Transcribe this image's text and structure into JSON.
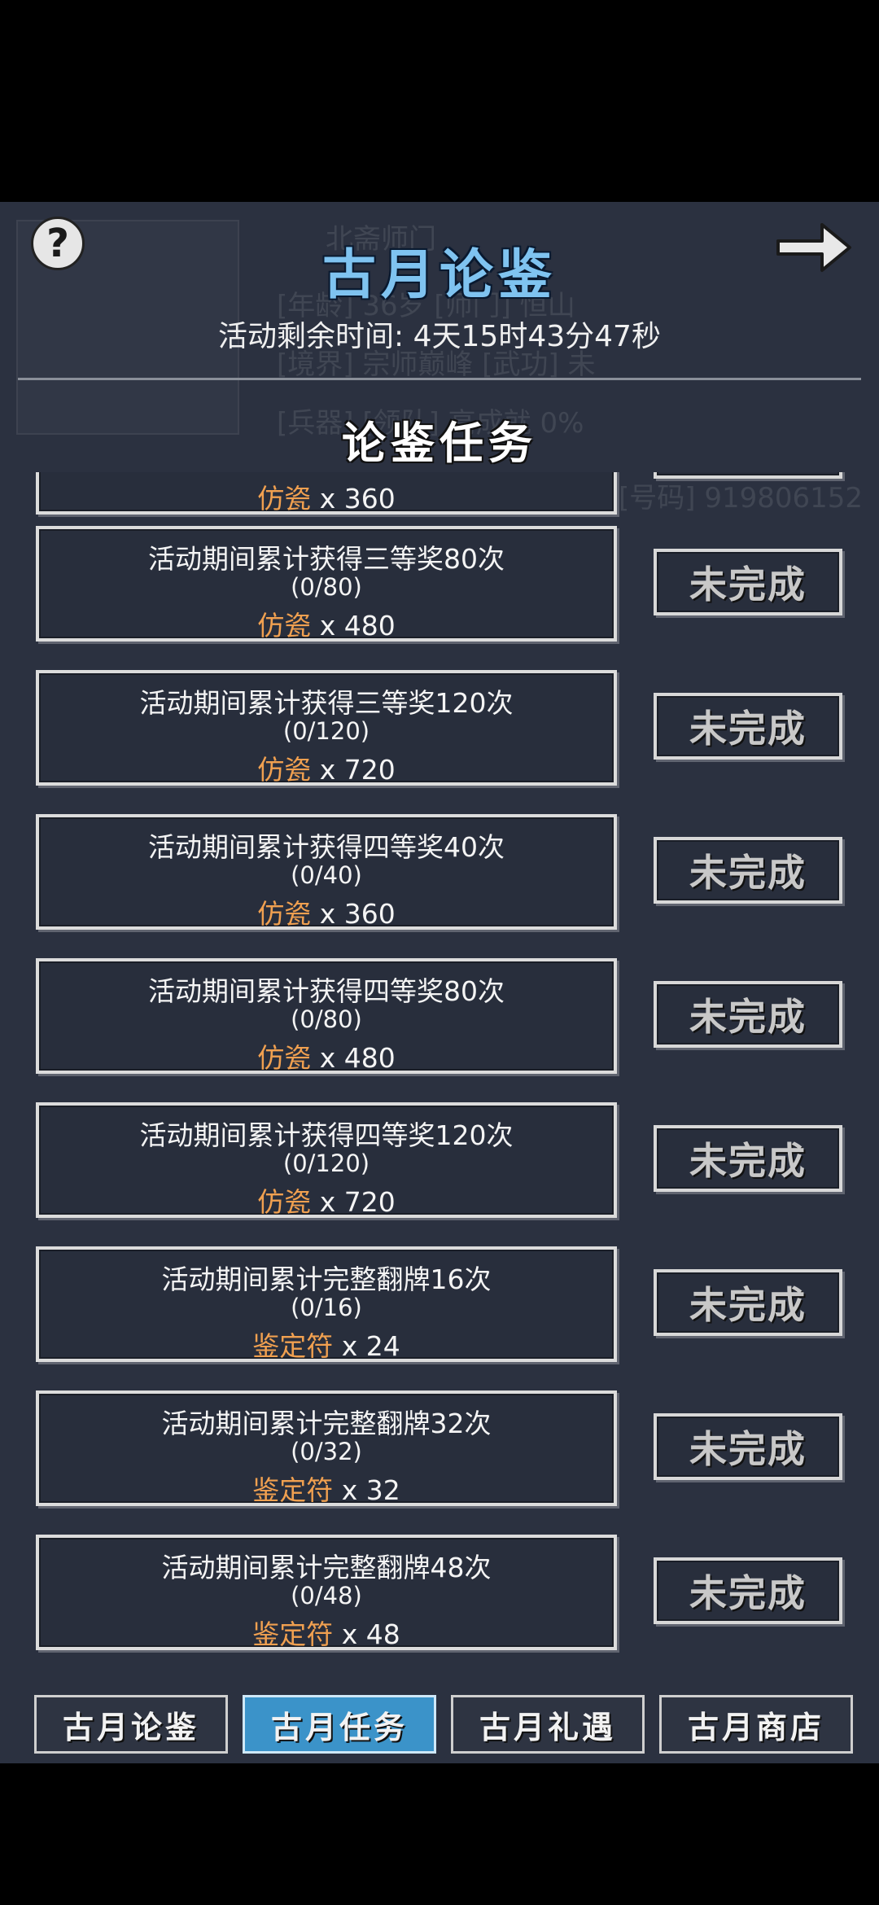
{
  "header": {
    "title": "古月论鉴",
    "timer_label": "活动剩余时间:",
    "timer_value": "4天15时43分47秒",
    "section_title": "论鉴任务"
  },
  "tasks": [
    {
      "desc": "",
      "progress": "",
      "reward_name": "仿瓷",
      "reward_qty": "x 360",
      "status": ""
    },
    {
      "desc": "活动期间累计获得三等奖80次",
      "progress": "(0/80)",
      "reward_name": "仿瓷",
      "reward_qty": "x 480",
      "status": "未完成"
    },
    {
      "desc": "活动期间累计获得三等奖120次",
      "progress": "(0/120)",
      "reward_name": "仿瓷",
      "reward_qty": "x 720",
      "status": "未完成"
    },
    {
      "desc": "活动期间累计获得四等奖40次",
      "progress": "(0/40)",
      "reward_name": "仿瓷",
      "reward_qty": "x 360",
      "status": "未完成"
    },
    {
      "desc": "活动期间累计获得四等奖80次",
      "progress": "(0/80)",
      "reward_name": "仿瓷",
      "reward_qty": "x 480",
      "status": "未完成"
    },
    {
      "desc": "活动期间累计获得四等奖120次",
      "progress": "(0/120)",
      "reward_name": "仿瓷",
      "reward_qty": "x 720",
      "status": "未完成"
    },
    {
      "desc": "活动期间累计完整翻牌16次",
      "progress": "(0/16)",
      "reward_name": "鉴定符",
      "reward_qty": "x 24",
      "status": "未完成"
    },
    {
      "desc": "活动期间累计完整翻牌32次",
      "progress": "(0/32)",
      "reward_name": "鉴定符",
      "reward_qty": "x 32",
      "status": "未完成"
    },
    {
      "desc": "活动期间累计完整翻牌48次",
      "progress": "(0/48)",
      "reward_name": "鉴定符",
      "reward_qty": "x 48",
      "status": "未完成"
    }
  ],
  "tabs": [
    {
      "label": "古月论鉴",
      "active": false
    },
    {
      "label": "古月任务",
      "active": true
    },
    {
      "label": "古月礼遇",
      "active": false
    },
    {
      "label": "古月商店",
      "active": false
    }
  ],
  "background_text": {
    "line1": "北斋师门",
    "line2": "[年龄] 36岁 [师门] 恒山",
    "line3": "[境界] 宗师巅峰 [武功] 未",
    "line4": "[兵器] [领队] 高成就 0%",
    "line5": "[号码] 919806152"
  },
  "icons": {
    "help": "question-mark-icon",
    "back": "right-arrow-icon"
  },
  "colors": {
    "title": "#7fc3f0",
    "reward": "#f0a050",
    "active_tab": "#3b93c9",
    "panel_bg": "#2b3140"
  }
}
